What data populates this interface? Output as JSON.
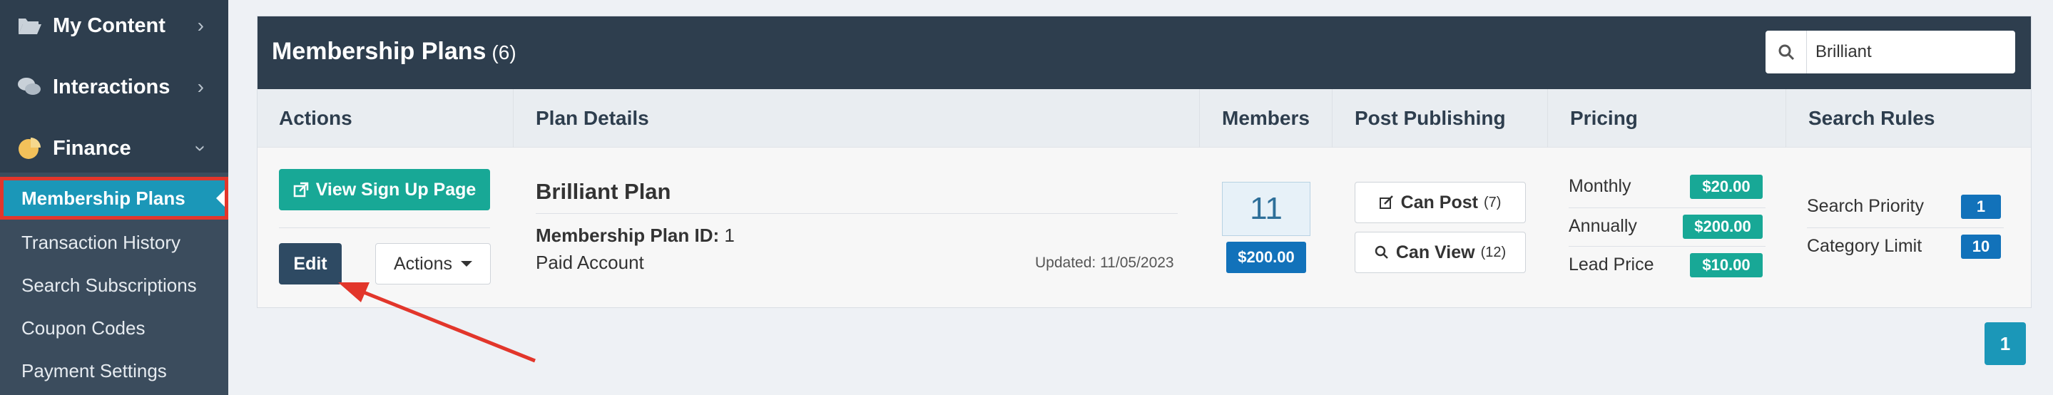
{
  "sidebar": {
    "items": [
      {
        "label": "My Content",
        "icon": "folder-icon"
      },
      {
        "label": "Interactions",
        "icon": "chat-icon"
      },
      {
        "label": "Finance",
        "icon": "pie-chart-icon"
      }
    ],
    "sub_items": [
      {
        "label": "Membership Plans",
        "active": true
      },
      {
        "label": "Transaction History"
      },
      {
        "label": "Search Subscriptions"
      },
      {
        "label": "Coupon Codes"
      },
      {
        "label": "Payment Settings"
      }
    ]
  },
  "panel": {
    "title": "Membership Plans",
    "count": "(6)",
    "search_value": "Brilliant"
  },
  "columns": [
    "Actions",
    "Plan Details",
    "Members",
    "Post Publishing",
    "Pricing",
    "Search Rules"
  ],
  "row": {
    "view_signup_label": "View Sign Up Page",
    "edit_label": "Edit",
    "actions_label": "Actions",
    "plan_name": "Brilliant Plan",
    "plan_id_label": "Membership Plan ID:",
    "plan_id_value": "1",
    "account_type": "Paid Account",
    "updated": "Updated: 11/05/2023",
    "members_count": "11",
    "members_revenue": "$200.00",
    "can_post_label": "Can Post",
    "can_post_count": "(7)",
    "can_view_label": "Can View",
    "can_view_count": "(12)",
    "pricing": [
      {
        "label": "Monthly",
        "value": "$20.00"
      },
      {
        "label": "Annually",
        "value": "$200.00"
      },
      {
        "label": "Lead Price",
        "value": "$10.00"
      }
    ],
    "search_rules": [
      {
        "label": "Search Priority",
        "value": "1"
      },
      {
        "label": "Category Limit",
        "value": "10"
      }
    ]
  },
  "pagination": {
    "current": "1"
  },
  "colors": {
    "header": "#2e3e4e",
    "teal": "#18a896",
    "active_nav": "#1b97b8",
    "badge_blue": "#1272ba",
    "annotation": "#e2362b"
  }
}
